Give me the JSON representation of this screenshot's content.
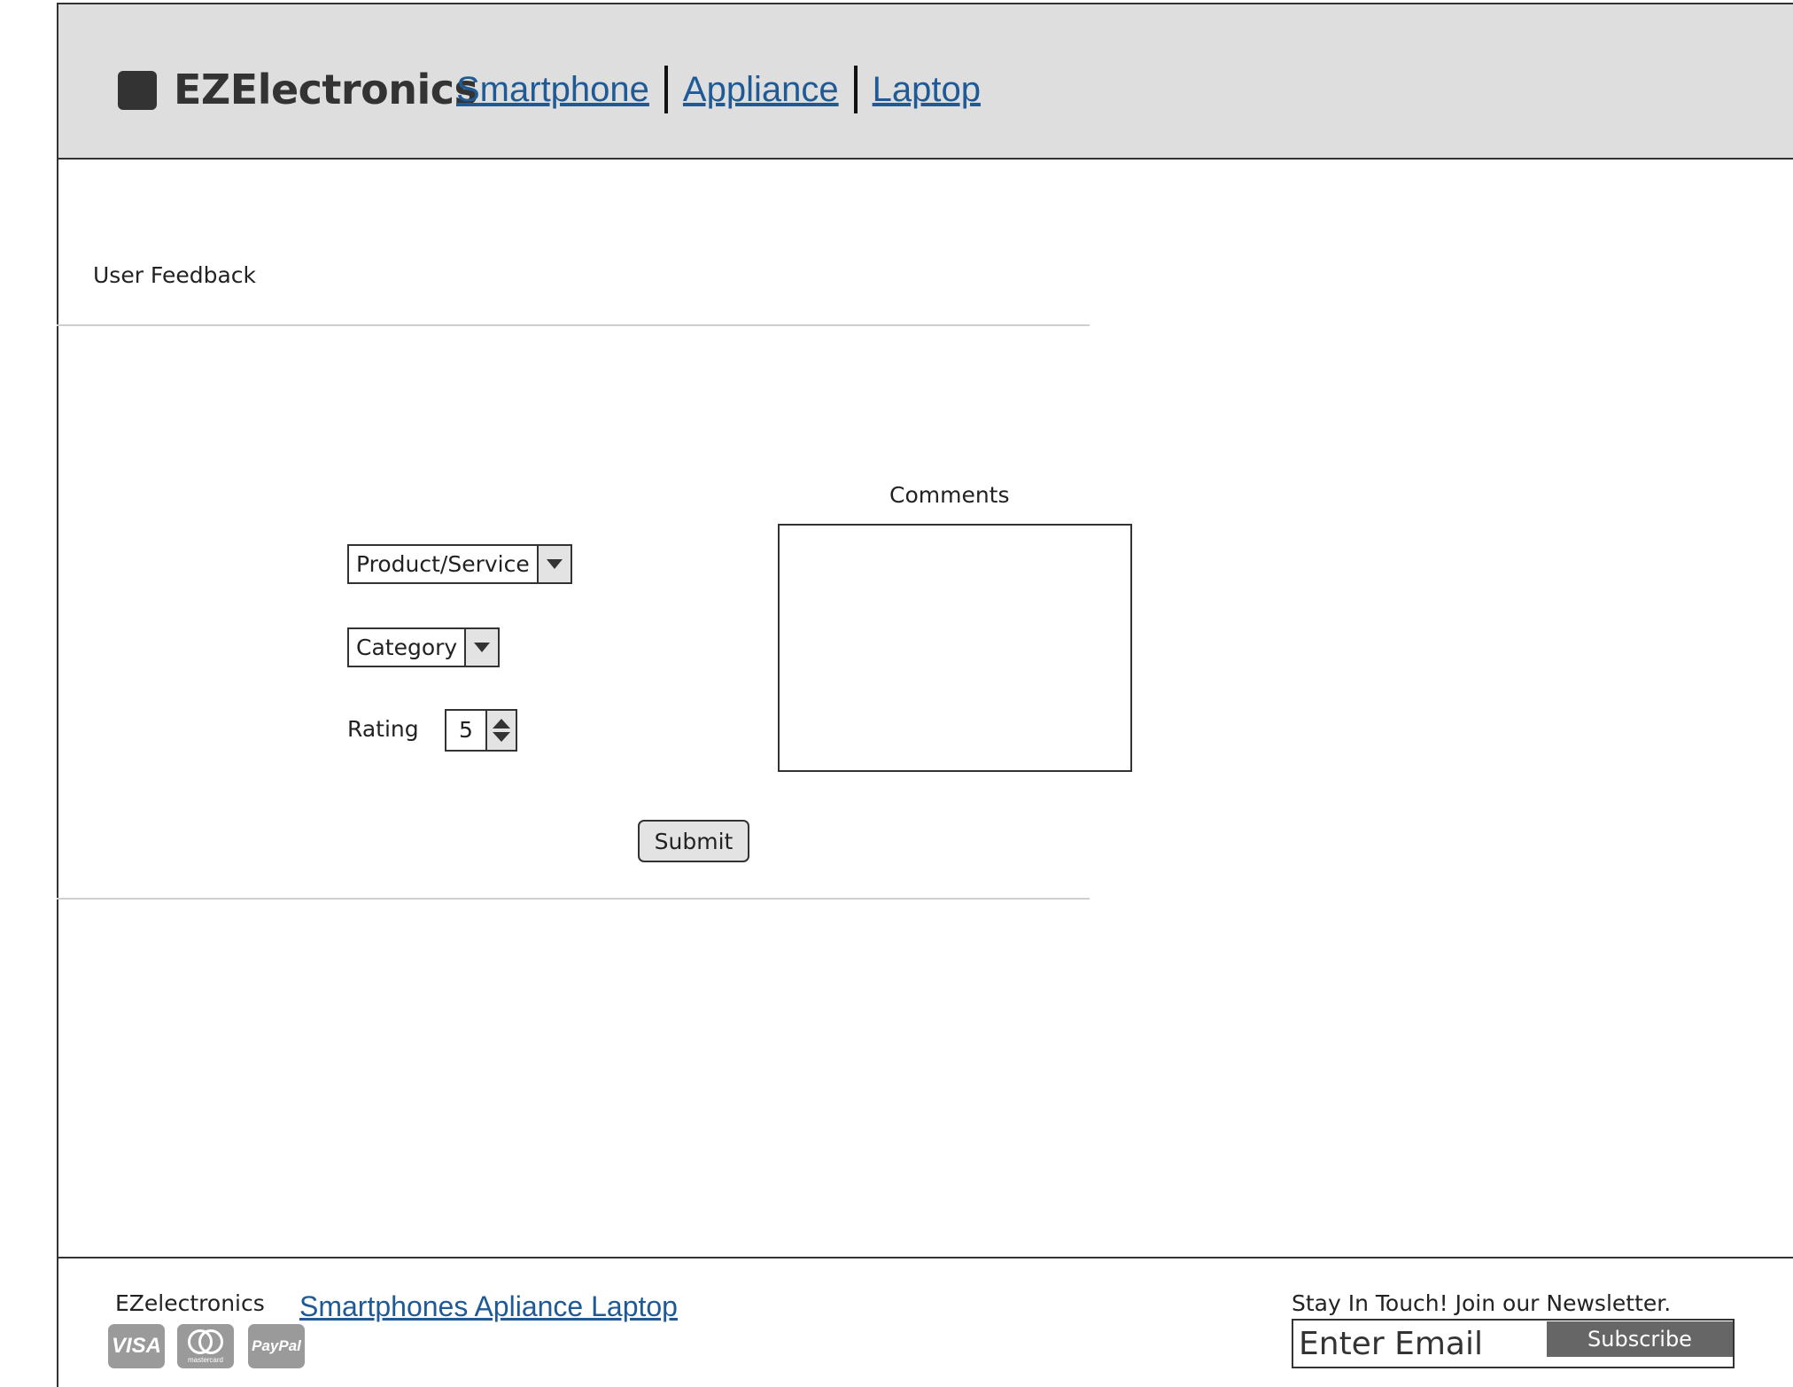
{
  "header": {
    "brand": "EZElectronics",
    "nav": [
      {
        "label": "Smartphone"
      },
      {
        "label": "Appliance"
      },
      {
        "label": "Laptop"
      }
    ]
  },
  "main": {
    "section_title": "User Feedback",
    "product_select": {
      "selected": "Product/Service"
    },
    "category_select": {
      "selected": "Category"
    },
    "rating": {
      "label": "Rating",
      "value": "5"
    },
    "comments": {
      "label": "Comments",
      "value": ""
    },
    "submit_label": "Submit"
  },
  "footer": {
    "brand": "EZelectronics",
    "links": "Smartphones Apliance Laptop",
    "payment_icons": [
      "visa-icon",
      "mastercard-icon",
      "paypal-icon"
    ],
    "visa_text": "VISA",
    "mastercard_text": "mastercard",
    "paypal_text": "PayPal",
    "newsletter_label": "Stay In Touch! Join our Newsletter.",
    "email_placeholder": "Enter Email",
    "subscribe_label": "Subscribe"
  },
  "colors": {
    "header_bg": "#dedede",
    "link": "#1f5a96",
    "subscribe_bg": "#666666"
  }
}
